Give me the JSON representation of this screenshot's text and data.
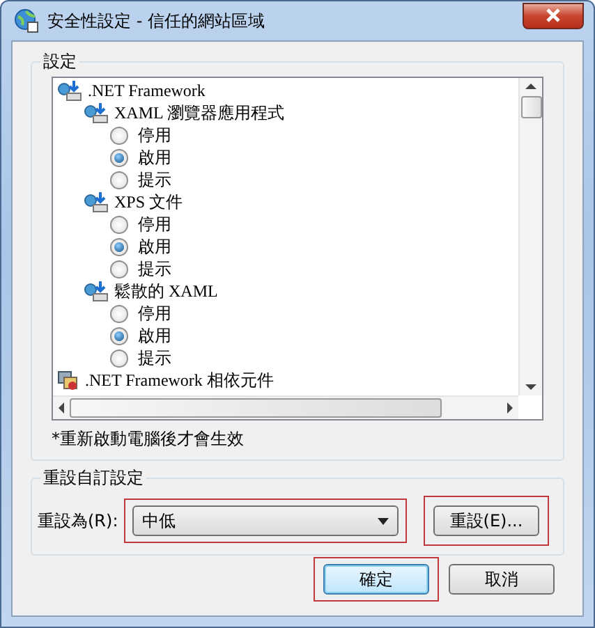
{
  "window": {
    "title": "安全性設定 - 信任的網站區域"
  },
  "settings_group": {
    "label": "設定",
    "tree": [
      {
        "label": ".NET Framework",
        "kind": "folder",
        "children": [
          {
            "label": "XAML 瀏覽器應用程式",
            "options": [
              {
                "label": "停用",
                "selected": false
              },
              {
                "label": "啟用",
                "selected": true
              },
              {
                "label": "提示",
                "selected": false
              }
            ]
          },
          {
            "label": "XPS 文件",
            "options": [
              {
                "label": "停用",
                "selected": false
              },
              {
                "label": "啟用",
                "selected": true
              },
              {
                "label": "提示",
                "selected": false
              }
            ]
          },
          {
            "label": "鬆散的 XAML",
            "options": [
              {
                "label": "停用",
                "selected": false
              },
              {
                "label": "啟用",
                "selected": true
              },
              {
                "label": "提示",
                "selected": false
              }
            ]
          }
        ]
      },
      {
        "label": ".NET Framework 相依元件",
        "kind": "component"
      }
    ],
    "note": "*重新啟動電腦後才會生效"
  },
  "reset_group": {
    "label": "重設自訂設定",
    "reset_to_label": "重設為(R):",
    "dropdown": {
      "value": "中低",
      "highlighted": true
    },
    "reset_button": {
      "label": "重設(E)...",
      "highlighted": true
    }
  },
  "buttons": [
    {
      "label": "確定",
      "default": true,
      "highlighted": true
    },
    {
      "label": "取消",
      "default": false,
      "highlighted": false
    }
  ]
}
